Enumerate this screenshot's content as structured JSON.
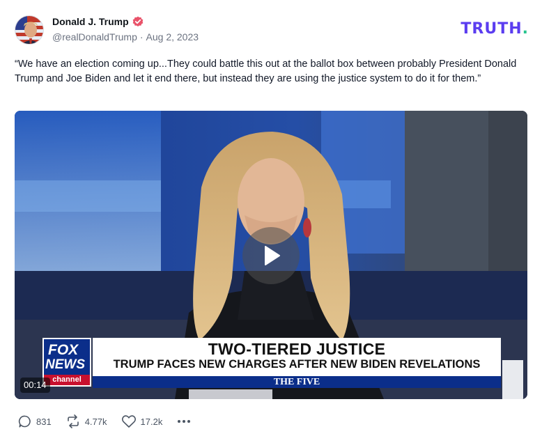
{
  "post": {
    "author": {
      "display_name": "Donald J. Trump",
      "handle": "@realDonaldTrump",
      "separator": "·",
      "date": "Aug 2, 2023",
      "verified": true
    },
    "brand": {
      "logo_text": "TRUTH",
      "logo_dot": ".",
      "colors": {
        "primary": "#5b3df0",
        "accent": "#27c48f"
      }
    },
    "text": "“We have an election coming up...They could battle this out at the ballot box between probably President Donald Trump and Joe Biden and let it end there, but instead they are using the justice system to do it for them.”",
    "media": {
      "duration": "00:14",
      "chyron": {
        "network_line1": "FOX",
        "network_line2": "NEWS",
        "network_line3": "channel",
        "headline": "TWO-TIERED JUSTICE",
        "subheadline": "TRUMP FACES NEW CHARGES AFTER NEW BIDEN REVELATIONS",
        "show": "THE FIVE"
      }
    },
    "stats": {
      "replies": "831",
      "retruths": "4.77k",
      "likes": "17.2k"
    }
  }
}
